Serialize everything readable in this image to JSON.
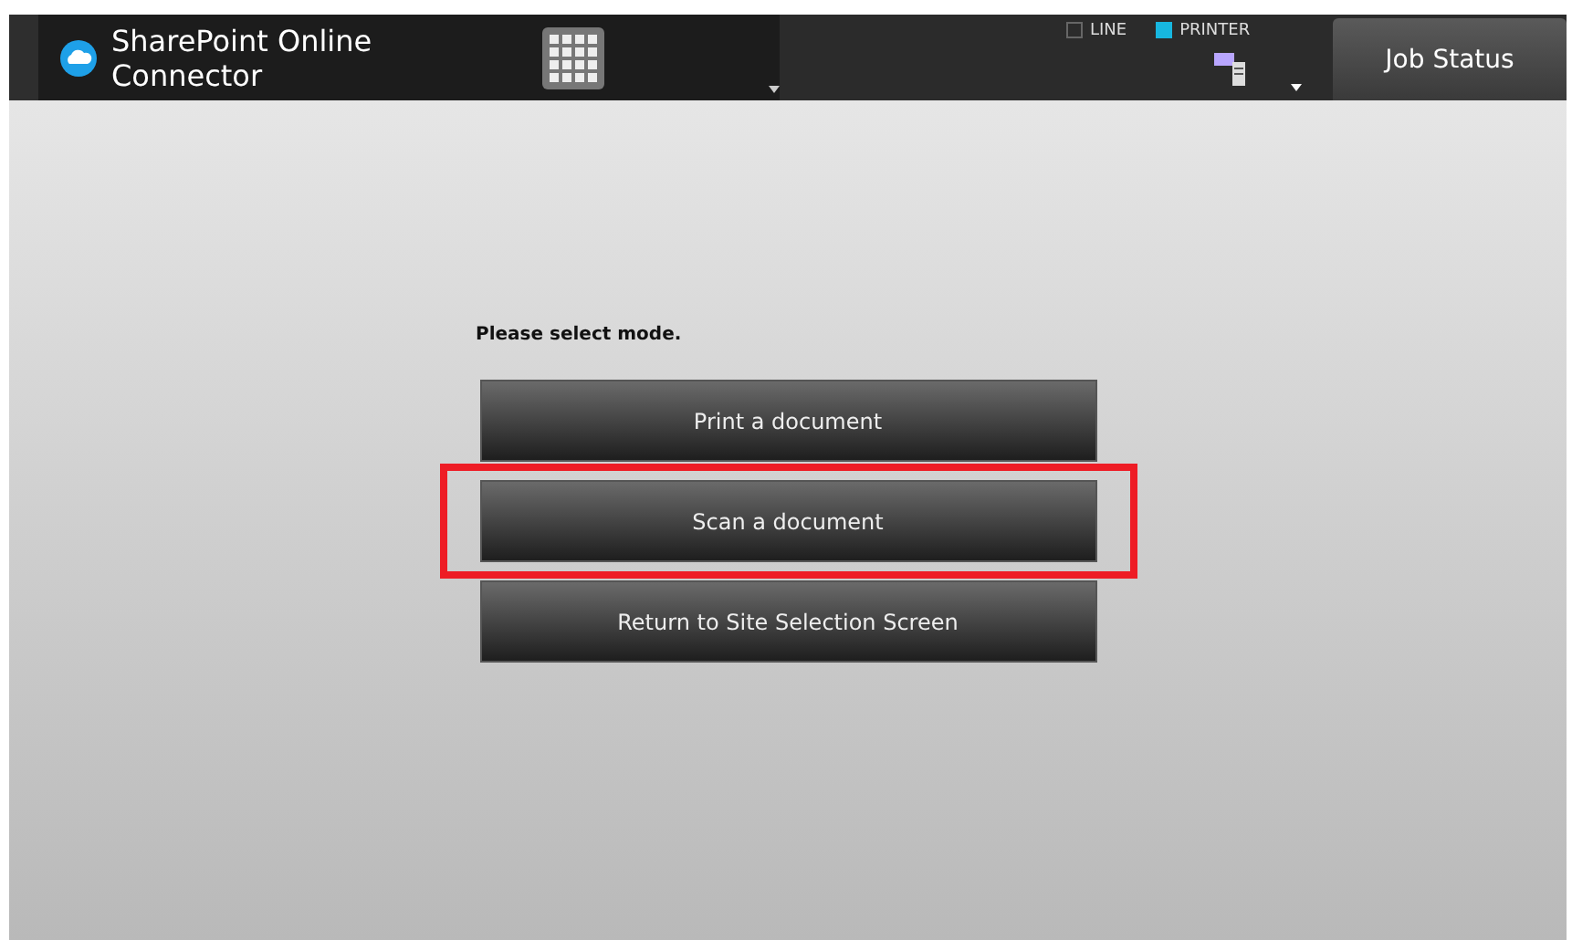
{
  "header": {
    "title_lines": [
      "SharePoint Online",
      "Connector"
    ],
    "indicators": [
      {
        "label": "LINE",
        "on": false
      },
      {
        "label": "PRINTER",
        "on": true
      }
    ],
    "job_status_button": "Job Status"
  },
  "prompt": "Please select mode.",
  "mode_buttons": [
    {
      "label": "Print a document",
      "highlighted": false
    },
    {
      "label": "Scan a document",
      "highlighted": true
    },
    {
      "label": "Return to Site Selection Screen",
      "highlighted": false
    }
  ]
}
